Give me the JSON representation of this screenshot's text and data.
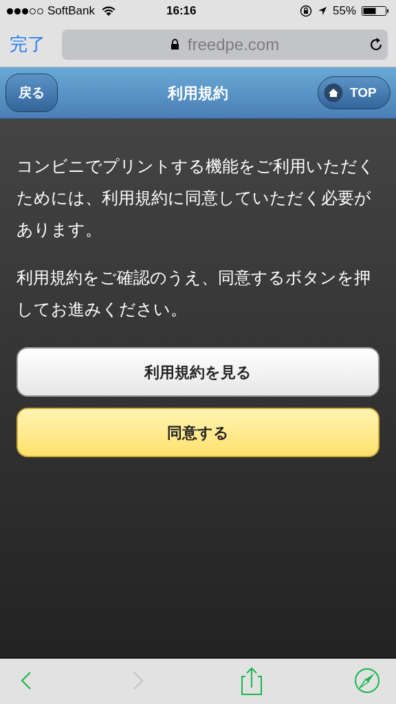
{
  "status_bar": {
    "carrier": "SoftBank",
    "time": "16:16",
    "battery": "55%"
  },
  "address_bar": {
    "done": "完了",
    "url": "freedpe.com"
  },
  "header": {
    "back": "戻る",
    "title": "利用規約",
    "top": "TOP"
  },
  "paragraphs": [
    "コンビニでプリントする機能をご利用いただくためには、利用規約に同意していただく必要があります。",
    "利用規約をご確認のうえ、同意するボタンを押してお進みください。"
  ],
  "buttons": [
    {
      "label": "利用規約を見る",
      "kind": "plain"
    },
    {
      "label": "同意する",
      "kind": "primary"
    }
  ],
  "toolbar": [
    {
      "kind": "back",
      "disabled": false
    },
    {
      "kind": "forward",
      "disabled": true
    },
    {
      "kind": "share",
      "disabled": false
    },
    {
      "kind": "compass",
      "disabled": false
    }
  ]
}
